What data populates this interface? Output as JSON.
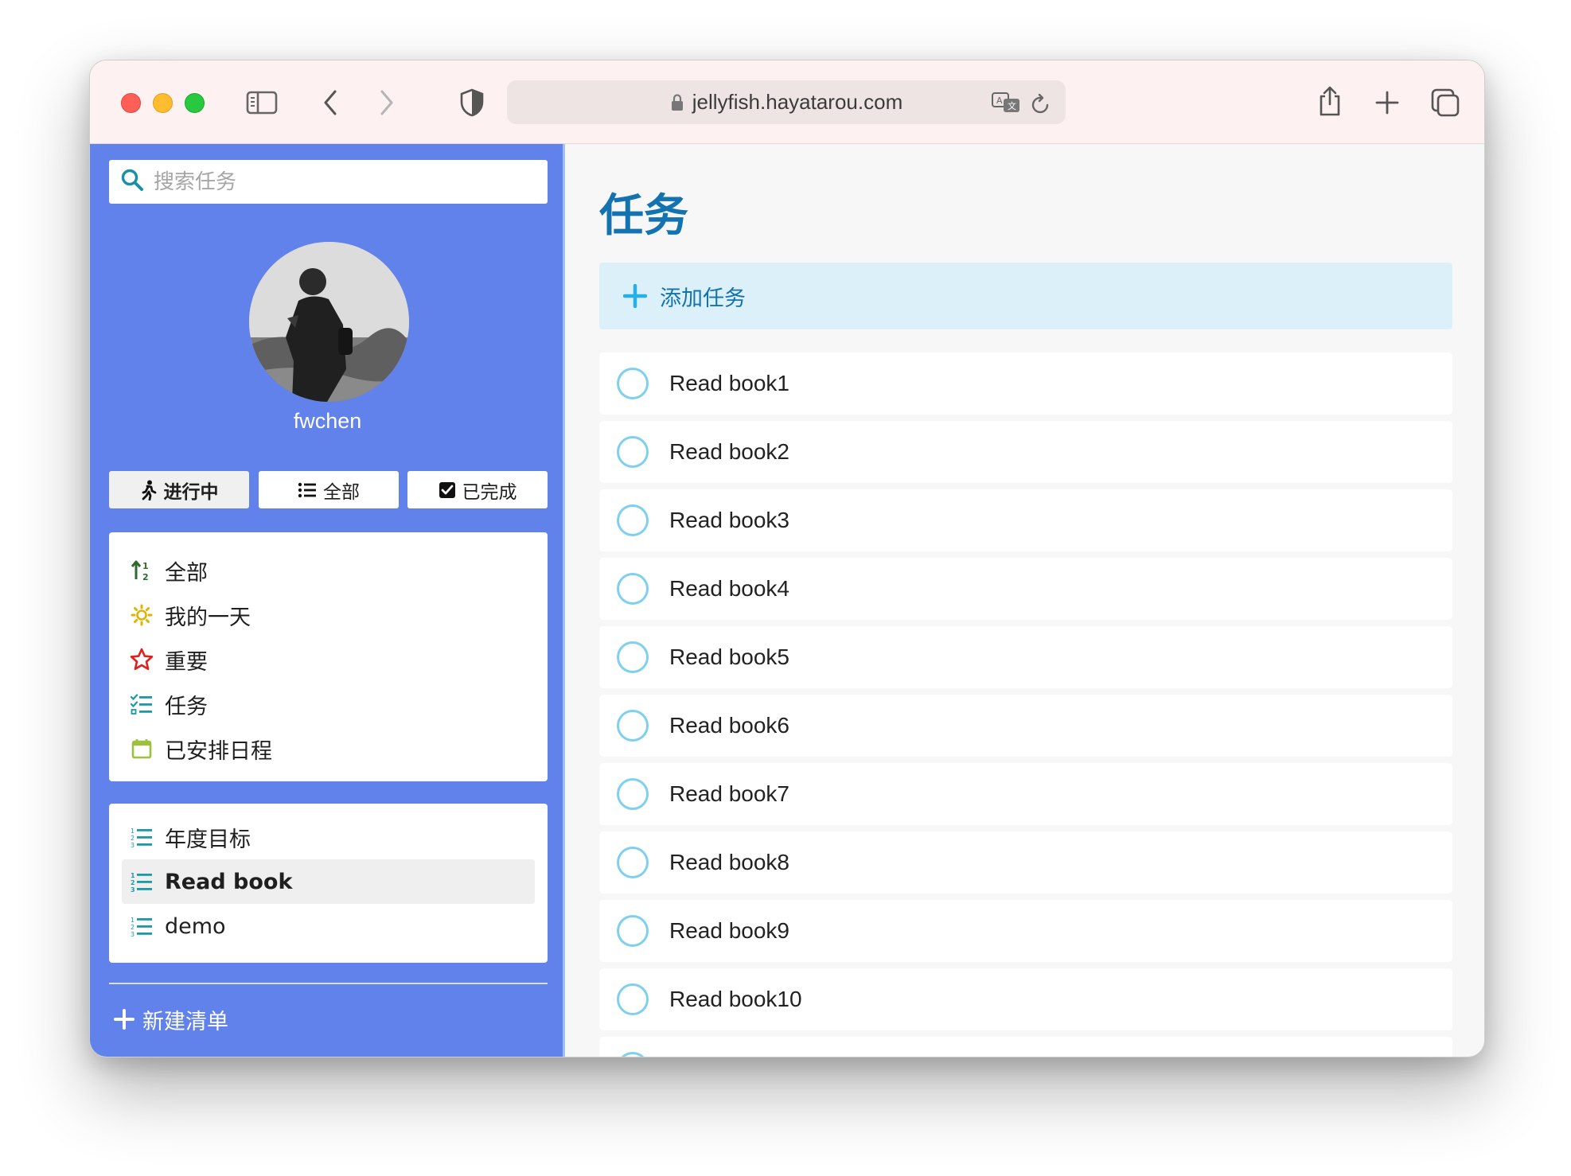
{
  "browser": {
    "url": "jellyfish.hayatarou.com"
  },
  "sidebar": {
    "search_placeholder": "搜索任务",
    "username": "fwchen",
    "filters": [
      {
        "label": "进行中",
        "icon": "walking-icon",
        "active": true
      },
      {
        "label": "全部",
        "icon": "list-icon",
        "active": false
      },
      {
        "label": "已完成",
        "icon": "checkbox-icon",
        "active": false
      }
    ],
    "smart_lists": [
      {
        "label": "全部",
        "icon": "sort-icon",
        "color": "#2e6b2e"
      },
      {
        "label": "我的一天",
        "icon": "sun-icon",
        "color": "#e0b400"
      },
      {
        "label": "重要",
        "icon": "star-icon",
        "color": "#e02020"
      },
      {
        "label": "任务",
        "icon": "tasks-icon",
        "color": "#1a9aa8"
      },
      {
        "label": "已安排日程",
        "icon": "calendar-icon",
        "color": "#9bc23a"
      }
    ],
    "user_lists": [
      {
        "label": "年度目标",
        "icon": "ordered-list-icon",
        "selected": false
      },
      {
        "label": "Read book",
        "icon": "ordered-list-icon",
        "selected": true
      },
      {
        "label": "demo",
        "icon": "ordered-list-icon",
        "selected": false
      }
    ],
    "new_list_label": "新建清单",
    "colors": {
      "background": "#6082ea",
      "accent": "#1273b0"
    }
  },
  "main": {
    "title": "任务",
    "add_task_label": "添加任务",
    "tasks": [
      {
        "title": "Read book1",
        "done": false
      },
      {
        "title": "Read book2",
        "done": false
      },
      {
        "title": "Read book3",
        "done": false
      },
      {
        "title": "Read book4",
        "done": false
      },
      {
        "title": "Read book5",
        "done": false
      },
      {
        "title": "Read book6",
        "done": false
      },
      {
        "title": "Read book7",
        "done": false
      },
      {
        "title": "Read book8",
        "done": false
      },
      {
        "title": "Read book9",
        "done": false
      },
      {
        "title": "Read book10",
        "done": false
      }
    ]
  }
}
